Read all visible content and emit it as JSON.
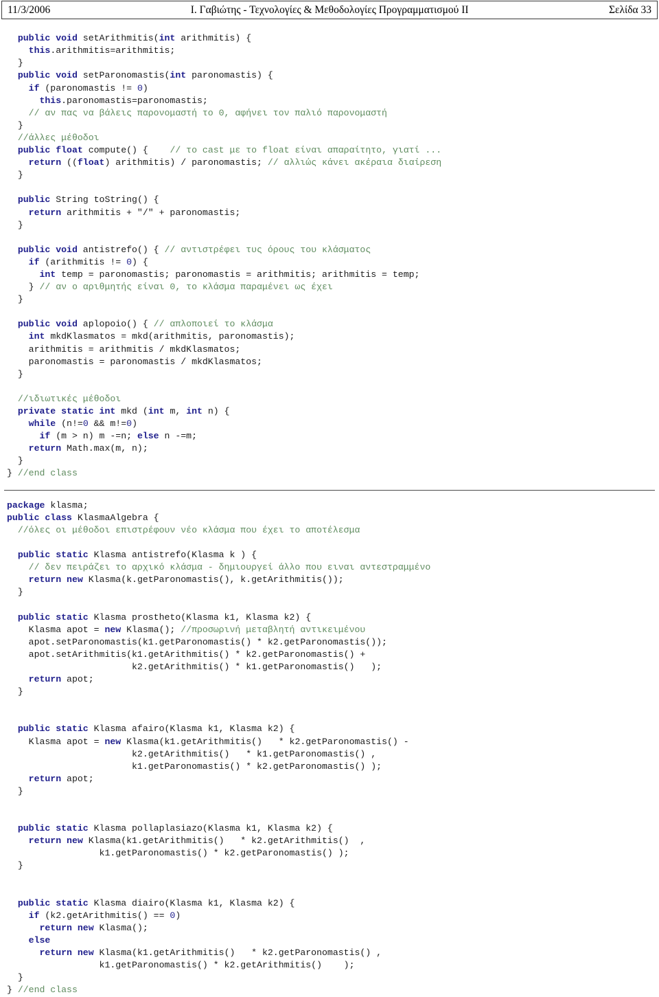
{
  "header": {
    "date": "11/3/2006",
    "title": "Ι. Γαβιώτης - Τεχνολογίες & Μεθοδολογίες Προγραμματισμού ΙΙ",
    "page_label": "Σελίδα 33"
  },
  "theme": {
    "keyword_color": "#1f1f8c",
    "comment_color": "#5e8b5e",
    "text_color": "#1a1a1a",
    "background": "#ffffff",
    "header_border": "#3a3a3a",
    "separator": "#4a4a4a"
  },
  "code_block_1": {
    "language": "java",
    "lines": [
      [
        {
          "t": "  ",
          "c": "pl"
        },
        {
          "t": "public void ",
          "c": "kw"
        },
        {
          "t": "setArithmitis(",
          "c": "pl"
        },
        {
          "t": "int",
          "c": "kw"
        },
        {
          "t": " arithmitis) {",
          "c": "pl"
        }
      ],
      [
        {
          "t": "    ",
          "c": "pl"
        },
        {
          "t": "this",
          "c": "kw"
        },
        {
          "t": ".arithmitis=arithmitis;",
          "c": "pl"
        }
      ],
      [
        {
          "t": "  }",
          "c": "pl"
        }
      ],
      [
        {
          "t": "  ",
          "c": "pl"
        },
        {
          "t": "public void ",
          "c": "kw"
        },
        {
          "t": "setParonomastis(",
          "c": "pl"
        },
        {
          "t": "int",
          "c": "kw"
        },
        {
          "t": " paronomastis) {",
          "c": "pl"
        }
      ],
      [
        {
          "t": "    ",
          "c": "pl"
        },
        {
          "t": "if",
          "c": "kw"
        },
        {
          "t": " (paronomastis != ",
          "c": "pl"
        },
        {
          "t": "0",
          "c": "num"
        },
        {
          "t": ")",
          "c": "pl"
        }
      ],
      [
        {
          "t": "      ",
          "c": "pl"
        },
        {
          "t": "this",
          "c": "kw"
        },
        {
          "t": ".paronomastis=paronomastis;",
          "c": "pl"
        }
      ],
      [
        {
          "t": "    ",
          "c": "pl"
        },
        {
          "t": "// αν πας να βάλεις παρονομαστή το 0, αφήνει τον παλιό παρονομαστή",
          "c": "cm"
        }
      ],
      [
        {
          "t": "  }",
          "c": "pl"
        }
      ],
      [
        {
          "t": "  ",
          "c": "pl"
        },
        {
          "t": "//άλλες μέθοδοι",
          "c": "cm"
        }
      ],
      [
        {
          "t": "  ",
          "c": "pl"
        },
        {
          "t": "public float ",
          "c": "kw"
        },
        {
          "t": "compute() {    ",
          "c": "pl"
        },
        {
          "t": "// το cast με το float είναι απαραίτητο, γιατί ...",
          "c": "cm"
        }
      ],
      [
        {
          "t": "    ",
          "c": "pl"
        },
        {
          "t": "return",
          "c": "kw"
        },
        {
          "t": " ((",
          "c": "pl"
        },
        {
          "t": "float",
          "c": "kw"
        },
        {
          "t": ") arithmitis) / paronomastis; ",
          "c": "pl"
        },
        {
          "t": "// αλλιώς κάνει ακέραια διαίρεση",
          "c": "cm"
        }
      ],
      [
        {
          "t": "  }",
          "c": "pl"
        }
      ],
      [
        {
          "t": "",
          "c": "pl"
        }
      ],
      [
        {
          "t": "  ",
          "c": "pl"
        },
        {
          "t": "public ",
          "c": "kw"
        },
        {
          "t": "String toString() {",
          "c": "pl"
        }
      ],
      [
        {
          "t": "    ",
          "c": "pl"
        },
        {
          "t": "return",
          "c": "kw"
        },
        {
          "t": " arithmitis + \"/\" + paronomastis;",
          "c": "pl"
        }
      ],
      [
        {
          "t": "  }",
          "c": "pl"
        }
      ],
      [
        {
          "t": "",
          "c": "pl"
        }
      ],
      [
        {
          "t": "  ",
          "c": "pl"
        },
        {
          "t": "public void ",
          "c": "kw"
        },
        {
          "t": "antistrefo() { ",
          "c": "pl"
        },
        {
          "t": "// αντιστρέφει τυς όρους του κλάσματος",
          "c": "cm"
        }
      ],
      [
        {
          "t": "    ",
          "c": "pl"
        },
        {
          "t": "if",
          "c": "kw"
        },
        {
          "t": " (arithmitis != ",
          "c": "pl"
        },
        {
          "t": "0",
          "c": "num"
        },
        {
          "t": ") {",
          "c": "pl"
        }
      ],
      [
        {
          "t": "      ",
          "c": "pl"
        },
        {
          "t": "int",
          "c": "kw"
        },
        {
          "t": " temp = paronomastis; paronomastis = arithmitis; arithmitis = temp;",
          "c": "pl"
        }
      ],
      [
        {
          "t": "    } ",
          "c": "pl"
        },
        {
          "t": "// αν ο αριθμητής είναι 0, το κλάσμα παραμένει ως έχει",
          "c": "cm"
        }
      ],
      [
        {
          "t": "  }",
          "c": "pl"
        }
      ],
      [
        {
          "t": "",
          "c": "pl"
        }
      ],
      [
        {
          "t": "  ",
          "c": "pl"
        },
        {
          "t": "public void ",
          "c": "kw"
        },
        {
          "t": "aplopoio() { ",
          "c": "pl"
        },
        {
          "t": "// απλοποιεί το κλάσμα",
          "c": "cm"
        }
      ],
      [
        {
          "t": "    ",
          "c": "pl"
        },
        {
          "t": "int",
          "c": "kw"
        },
        {
          "t": " mkdKlasmatos = mkd(arithmitis, paronomastis);",
          "c": "pl"
        }
      ],
      [
        {
          "t": "    arithmitis = arithmitis / mkdKlasmatos;",
          "c": "pl"
        }
      ],
      [
        {
          "t": "    paronomastis = paronomastis / mkdKlasmatos;",
          "c": "pl"
        }
      ],
      [
        {
          "t": "  }",
          "c": "pl"
        }
      ],
      [
        {
          "t": "",
          "c": "pl"
        }
      ],
      [
        {
          "t": "  ",
          "c": "pl"
        },
        {
          "t": "//ιδιωτικές μέθοδοι",
          "c": "cm"
        }
      ],
      [
        {
          "t": "  ",
          "c": "pl"
        },
        {
          "t": "private static int ",
          "c": "kw"
        },
        {
          "t": "mkd (",
          "c": "pl"
        },
        {
          "t": "int",
          "c": "kw"
        },
        {
          "t": " m, ",
          "c": "pl"
        },
        {
          "t": "int",
          "c": "kw"
        },
        {
          "t": " n) {",
          "c": "pl"
        }
      ],
      [
        {
          "t": "    ",
          "c": "pl"
        },
        {
          "t": "while",
          "c": "kw"
        },
        {
          "t": " (n!=",
          "c": "pl"
        },
        {
          "t": "0",
          "c": "num"
        },
        {
          "t": " && m!=",
          "c": "pl"
        },
        {
          "t": "0",
          "c": "num"
        },
        {
          "t": ")",
          "c": "pl"
        }
      ],
      [
        {
          "t": "      ",
          "c": "pl"
        },
        {
          "t": "if",
          "c": "kw"
        },
        {
          "t": " (m > n) m -=n; ",
          "c": "pl"
        },
        {
          "t": "else",
          "c": "kw"
        },
        {
          "t": " n -=m;",
          "c": "pl"
        }
      ],
      [
        {
          "t": "    ",
          "c": "pl"
        },
        {
          "t": "return",
          "c": "kw"
        },
        {
          "t": " Math.max(m, n);",
          "c": "pl"
        }
      ],
      [
        {
          "t": "  }",
          "c": "pl"
        }
      ],
      [
        {
          "t": "} ",
          "c": "pl"
        },
        {
          "t": "//end class",
          "c": "cm"
        }
      ]
    ]
  },
  "code_block_2": {
    "language": "java",
    "lines": [
      [
        {
          "t": "package",
          "c": "kw"
        },
        {
          "t": " klasma;",
          "c": "pl"
        }
      ],
      [
        {
          "t": "public class ",
          "c": "kw"
        },
        {
          "t": "KlasmaAlgebra {",
          "c": "pl"
        }
      ],
      [
        {
          "t": "  ",
          "c": "pl"
        },
        {
          "t": "//όλες οι μέθοδοι επιστρέφουν νέο κλάσμα που έχει το αποτέλεσμα",
          "c": "cm"
        }
      ],
      [
        {
          "t": "",
          "c": "pl"
        }
      ],
      [
        {
          "t": "  ",
          "c": "pl"
        },
        {
          "t": "public static ",
          "c": "kw"
        },
        {
          "t": "Klasma antistrefo(Klasma k ) {",
          "c": "pl"
        }
      ],
      [
        {
          "t": "    ",
          "c": "pl"
        },
        {
          "t": "// δεν πειράζει το αρχικό κλάσμα - δημιουργεί άλλο που ειναι αντεστραμμένο",
          "c": "cm"
        }
      ],
      [
        {
          "t": "    ",
          "c": "pl"
        },
        {
          "t": "return new ",
          "c": "kw"
        },
        {
          "t": "Klasma(k.getParonomastis(), k.getArithmitis());",
          "c": "pl"
        }
      ],
      [
        {
          "t": "  }",
          "c": "pl"
        }
      ],
      [
        {
          "t": "",
          "c": "pl"
        }
      ],
      [
        {
          "t": "  ",
          "c": "pl"
        },
        {
          "t": "public static ",
          "c": "kw"
        },
        {
          "t": "Klasma prostheto(Klasma k1, Klasma k2) {",
          "c": "pl"
        }
      ],
      [
        {
          "t": "    Klasma apot = ",
          "c": "pl"
        },
        {
          "t": "new",
          "c": "kw"
        },
        {
          "t": " Klasma(); ",
          "c": "pl"
        },
        {
          "t": "//προσωρινή μεταβλητή αντικειμένου",
          "c": "cm"
        }
      ],
      [
        {
          "t": "    apot.setParonomastis(k1.getParonomastis() * k2.getParonomastis());",
          "c": "pl"
        }
      ],
      [
        {
          "t": "    apot.setArithmitis(k1.getArithmitis() * k2.getParonomastis() +",
          "c": "pl"
        }
      ],
      [
        {
          "t": "                       k2.getArithmitis() * k1.getParonomastis()   );",
          "c": "pl"
        }
      ],
      [
        {
          "t": "    ",
          "c": "pl"
        },
        {
          "t": "return",
          "c": "kw"
        },
        {
          "t": " apot;",
          "c": "pl"
        }
      ],
      [
        {
          "t": "  }",
          "c": "pl"
        }
      ],
      [
        {
          "t": "",
          "c": "pl"
        }
      ],
      [
        {
          "t": "",
          "c": "pl"
        }
      ],
      [
        {
          "t": "  ",
          "c": "pl"
        },
        {
          "t": "public static ",
          "c": "kw"
        },
        {
          "t": "Klasma afairo(Klasma k1, Klasma k2) {",
          "c": "pl"
        }
      ],
      [
        {
          "t": "    Klasma apot = ",
          "c": "pl"
        },
        {
          "t": "new",
          "c": "kw"
        },
        {
          "t": " Klasma(k1.getArithmitis()   * k2.getParonomastis() -",
          "c": "pl"
        }
      ],
      [
        {
          "t": "                       k2.getArithmitis()   * k1.getParonomastis() ,",
          "c": "pl"
        }
      ],
      [
        {
          "t": "                       k1.getParonomastis() * k2.getParonomastis() );",
          "c": "pl"
        }
      ],
      [
        {
          "t": "    ",
          "c": "pl"
        },
        {
          "t": "return",
          "c": "kw"
        },
        {
          "t": " apot;",
          "c": "pl"
        }
      ],
      [
        {
          "t": "  }",
          "c": "pl"
        }
      ],
      [
        {
          "t": "",
          "c": "pl"
        }
      ],
      [
        {
          "t": "",
          "c": "pl"
        }
      ],
      [
        {
          "t": "  ",
          "c": "pl"
        },
        {
          "t": "public static ",
          "c": "kw"
        },
        {
          "t": "Klasma pollaplasiazo(Klasma k1, Klasma k2) {",
          "c": "pl"
        }
      ],
      [
        {
          "t": "    ",
          "c": "pl"
        },
        {
          "t": "return new ",
          "c": "kw"
        },
        {
          "t": "Klasma(k1.getArithmitis()   * k2.getArithmitis()  ,",
          "c": "pl"
        }
      ],
      [
        {
          "t": "                 k1.getParonomastis() * k2.getParonomastis() );",
          "c": "pl"
        }
      ],
      [
        {
          "t": "  }",
          "c": "pl"
        }
      ],
      [
        {
          "t": "",
          "c": "pl"
        }
      ],
      [
        {
          "t": "",
          "c": "pl"
        }
      ],
      [
        {
          "t": "  ",
          "c": "pl"
        },
        {
          "t": "public static ",
          "c": "kw"
        },
        {
          "t": "Klasma diairo(Klasma k1, Klasma k2) {",
          "c": "pl"
        }
      ],
      [
        {
          "t": "    ",
          "c": "pl"
        },
        {
          "t": "if",
          "c": "kw"
        },
        {
          "t": " (k2.getArithmitis() == ",
          "c": "pl"
        },
        {
          "t": "0",
          "c": "num"
        },
        {
          "t": ")",
          "c": "pl"
        }
      ],
      [
        {
          "t": "      ",
          "c": "pl"
        },
        {
          "t": "return new ",
          "c": "kw"
        },
        {
          "t": "Klasma();",
          "c": "pl"
        }
      ],
      [
        {
          "t": "    ",
          "c": "pl"
        },
        {
          "t": "else",
          "c": "kw"
        }
      ],
      [
        {
          "t": "      ",
          "c": "pl"
        },
        {
          "t": "return new ",
          "c": "kw"
        },
        {
          "t": "Klasma(k1.getArithmitis()   * k2.getParonomastis() ,",
          "c": "pl"
        }
      ],
      [
        {
          "t": "                 k1.getParonomastis() * k2.getArithmitis()    );",
          "c": "pl"
        }
      ],
      [
        {
          "t": "  }",
          "c": "pl"
        }
      ],
      [
        {
          "t": "} ",
          "c": "pl"
        },
        {
          "t": "//end class",
          "c": "cm"
        }
      ]
    ]
  }
}
